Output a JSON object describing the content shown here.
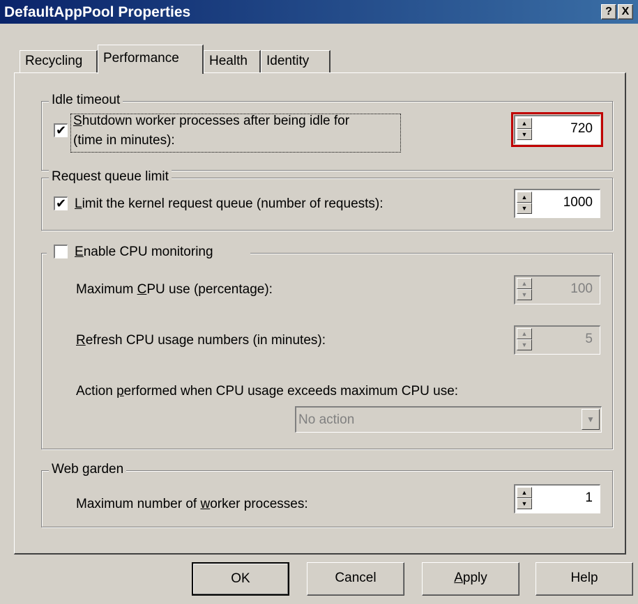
{
  "window": {
    "title": "DefaultAppPool Properties",
    "help_glyph": "?",
    "close_glyph": "X"
  },
  "tabs": [
    {
      "label": "Recycling",
      "active": false
    },
    {
      "label": "Performance",
      "active": true
    },
    {
      "label": "Health",
      "active": false
    },
    {
      "label": "Identity",
      "active": false
    }
  ],
  "idle_timeout": {
    "legend": "Idle timeout",
    "checked": true,
    "label_line1_key": "S",
    "label_line1_rest": "hutdown worker processes after being idle for",
    "label_line2": "(time in minutes):",
    "value": "720",
    "highlight_color": "#c00000"
  },
  "request_queue": {
    "legend": "Request queue limit",
    "checked": true,
    "label_key": "L",
    "label_rest": "imit the kernel request queue (number of requests):",
    "value": "1000"
  },
  "cpu_monitoring": {
    "checked": false,
    "label_key": "E",
    "label_rest": "nable CPU monitoring",
    "max_cpu_pre": "Maximum ",
    "max_cpu_key": "C",
    "max_cpu_rest": "PU use (percentage):",
    "max_cpu_value": "100",
    "refresh_key": "R",
    "refresh_rest": "efresh CPU usage numbers (in minutes):",
    "refresh_value": "5",
    "action_pre": "Action ",
    "action_key": "p",
    "action_rest": "erformed when CPU usage exceeds maximum CPU use:",
    "action_value": "No action"
  },
  "web_garden": {
    "legend": "Web garden",
    "label_pre": "Maximum number of ",
    "label_key": "w",
    "label_rest": "orker processes:",
    "value": "1"
  },
  "buttons": {
    "ok": "OK",
    "cancel": "Cancel",
    "apply_key": "A",
    "apply_rest": "pply",
    "help": "Help"
  },
  "icons": {
    "check": "✔",
    "spin_up": "▲",
    "spin_down": "▼",
    "combo_arrow": "▼"
  }
}
